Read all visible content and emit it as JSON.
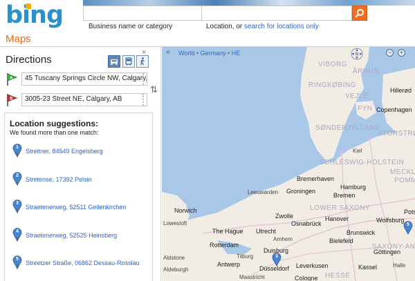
{
  "brand": {
    "logo": "bing",
    "accent": "#e36c1b",
    "logo_color": "#2b91c8"
  },
  "search": {
    "what_hint": "Business name or category",
    "where_hint": "Location, or",
    "where_link": "search for locations only"
  },
  "section": {
    "title": "Maps"
  },
  "directions": {
    "title": "Directions",
    "close": "×",
    "modes": [
      "car-icon",
      "bus-icon",
      "walk-icon"
    ],
    "start": "45 Tuscany Springs Circle NW, Calgary, A",
    "end": "3005-23 Street NE, Calgary, AB",
    "swap": "⇅"
  },
  "suggestions": {
    "title": "Location suggestions:",
    "subtitle": "We found more than one match:",
    "items": [
      {
        "num": "1",
        "label": "Streitner, 84549 Engelsberg"
      },
      {
        "num": "2",
        "label": "Stretense, 17392 Pelsin"
      },
      {
        "num": "3",
        "label": "Straetenerweg, 52511 Geilenkirchen"
      },
      {
        "num": "4",
        "label": "Straetenerweg, 52525 Heinsberg"
      },
      {
        "num": "5",
        "label": "Streetzer Straße, 06862 Dessau-Rosslau"
      }
    ]
  },
  "map": {
    "collapse": "«",
    "breadcrumb": [
      "World",
      "Germany",
      "HE"
    ],
    "compass": "N",
    "zoom_out": "−",
    "zoom_in": "+",
    "regions": [
      "VIBORG",
      "ÅRHUS",
      "RINGKØBING",
      "VEJLE",
      "FYN",
      "SØNDERJYLLAND",
      "STORSTRØM",
      "SCHLESWIG-HOLSTEIN",
      "MECKLENB",
      "POMMERN",
      "LOWER SAXONY",
      "SAXONY-AN",
      "HESSE"
    ],
    "cities": [
      "Hillerød",
      "Copenhagen",
      "Hamburg",
      "Bremerhaven",
      "Groningen",
      "Bremen",
      "Wolfsburg",
      "Potsd",
      "Zwolle",
      "Hanover",
      "The Hague",
      "Osnabrück",
      "Brunswick",
      "Utrecht",
      "Rotterdam",
      "Bielefeld",
      "Duisburg",
      "Göttingen",
      "Düsseldorf",
      "Leverkusen",
      "Kassel",
      "Cologne",
      "Antwerp",
      "Norwich",
      "Lowestoft",
      "Tilburg",
      "Maastricht",
      "Leeuwarden",
      "Aldstone",
      "Aldeburgh",
      "Arnhem",
      "Kiel",
      "Halle"
    ],
    "pin_labels": [
      "3",
      "5"
    ]
  }
}
